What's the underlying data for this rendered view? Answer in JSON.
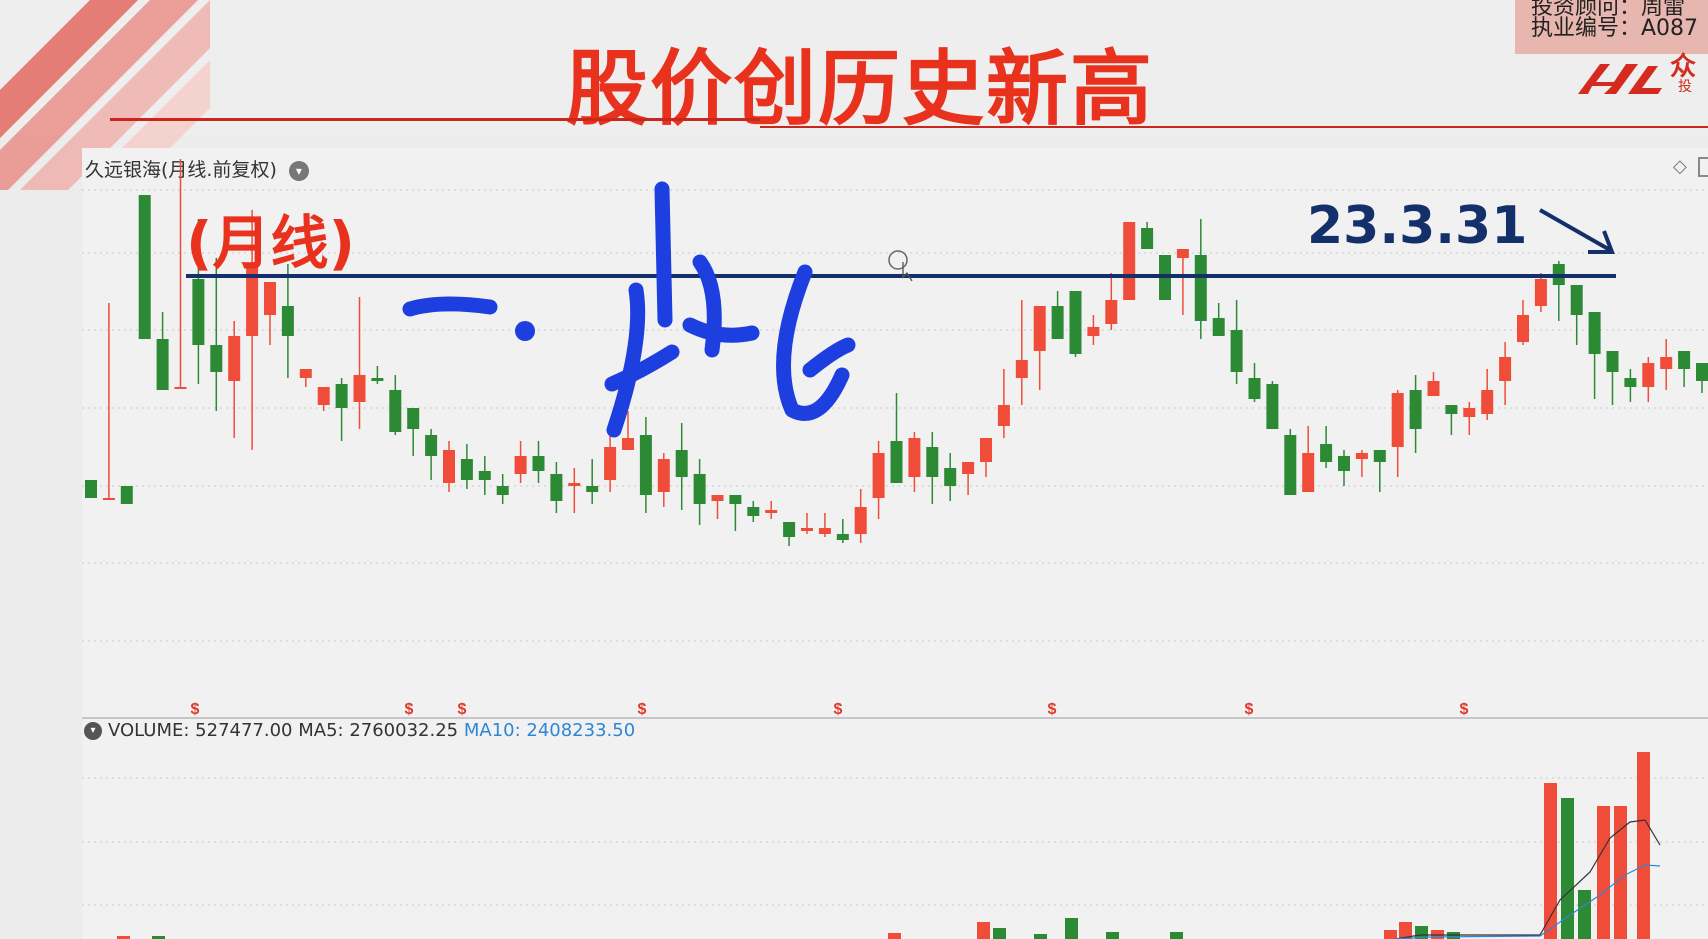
{
  "banner": {
    "title": "股价创历史新高",
    "advisor_line1": "投资顾问：周雷",
    "advisor_line2": "执业编号：A087",
    "logo_text": "众",
    "logo_sub": "投"
  },
  "chart": {
    "stock_label": "久远银海(月线.前复权)",
    "annotation_period": "(月线)",
    "annotation_date": "23.3.31",
    "handwriting": "一."
  },
  "volume": {
    "label": "VOLUME: 527477.00",
    "ma5": "MA5: 2760032.25",
    "ma10": "MA10: 2408233.50"
  },
  "colors": {
    "up": "#ef4c3a",
    "down": "#2c8a35",
    "title_red": "#e8321e",
    "annotation_navy": "#14306a",
    "handwriting_blue": "#1d3fe0",
    "ma10_blue": "#2e86d6"
  },
  "chart_data": {
    "type": "candlestick",
    "period": "monthly",
    "dividend_marker": "$",
    "candles": [
      [
        135,
        129,
        135,
        129
      ],
      [
        129,
        129,
        194,
        133
      ],
      [
        133,
        127,
        133,
        127
      ],
      [
        230,
        182,
        230,
        188
      ],
      [
        182,
        165,
        165,
        191
      ],
      [
        166,
        166,
        242,
        191
      ],
      [
        202,
        180,
        222,
        167
      ],
      [
        180,
        171,
        209,
        158
      ],
      [
        168,
        183,
        188,
        149
      ],
      [
        183,
        207,
        225,
        145
      ],
      [
        190,
        201,
        191,
        180
      ],
      [
        193,
        183,
        207,
        169
      ],
      [
        169,
        172,
        166,
        166
      ],
      [
        160,
        166,
        158,
        161
      ],
      [
        167,
        159,
        169,
        148
      ],
      [
        161,
        170,
        196,
        152
      ],
      [
        169,
        168,
        167,
        173
      ],
      [
        165,
        151,
        170,
        150
      ],
      [
        159,
        152,
        157,
        143
      ],
      [
        150,
        143,
        152,
        135
      ],
      [
        134,
        145,
        131,
        148
      ],
      [
        142,
        135,
        147,
        132
      ],
      [
        138,
        135,
        143,
        130
      ],
      [
        133,
        130,
        137,
        127
      ],
      [
        137,
        143,
        134,
        148
      ],
      [
        143,
        138,
        148,
        134
      ],
      [
        137,
        128,
        141,
        124
      ],
      [
        133,
        134,
        139,
        124
      ],
      [
        133,
        131,
        142,
        127
      ],
      [
        135,
        146,
        131,
        151
      ],
      [
        145,
        149,
        147,
        158
      ],
      [
        150,
        130,
        156,
        124
      ],
      [
        131,
        142,
        144,
        126
      ],
      [
        145,
        136,
        154,
        125
      ],
      [
        137,
        127,
        142,
        120
      ],
      [
        128,
        130,
        122,
        122
      ],
      [
        130,
        127,
        130,
        118
      ],
      [
        126,
        123,
        128,
        121
      ],
      [
        124,
        125,
        128,
        122
      ],
      [
        121,
        116,
        120,
        113
      ],
      [
        118,
        119,
        124,
        117
      ],
      [
        117,
        119,
        124,
        116
      ],
      [
        117,
        115,
        122,
        114
      ],
      [
        117,
        126,
        132,
        114
      ],
      [
        129,
        144,
        148,
        122
      ],
      [
        148,
        134,
        164,
        136
      ],
      [
        136,
        149,
        151,
        131
      ],
      [
        146,
        136,
        151,
        127
      ],
      [
        139,
        133,
        144,
        128
      ],
      [
        137,
        141,
        134,
        130
      ],
      [
        141,
        149,
        147,
        136
      ],
      [
        153,
        160,
        172,
        149
      ],
      [
        169,
        175,
        195,
        160
      ],
      [
        178,
        193,
        172,
        165
      ],
      [
        193,
        182,
        183,
        198
      ],
      [
        198,
        177,
        189,
        176
      ],
      [
        183,
        186,
        190,
        180
      ],
      [
        187,
        195,
        204,
        185
      ],
      [
        195,
        221,
        214,
        206
      ],
      [
        219,
        212,
        217,
        221
      ],
      [
        210,
        195,
        207,
        198
      ],
      [
        209,
        212,
        209,
        190
      ],
      [
        210,
        188,
        222,
        182
      ],
      [
        189,
        183,
        185,
        194
      ],
      [
        185,
        171,
        195,
        167
      ],
      [
        169,
        162,
        161,
        174
      ],
      [
        167,
        152,
        158,
        168
      ],
      [
        150,
        130,
        148,
        152
      ],
      [
        131,
        144,
        138,
        153
      ],
      [
        147,
        141,
        153,
        139
      ],
      [
        143,
        138,
        145,
        133
      ],
      [
        142,
        144,
        145,
        136
      ],
      [
        145,
        141,
        143,
        131
      ],
      [
        146,
        164,
        165,
        136
      ],
      [
        165,
        152,
        170,
        144
      ],
      [
        163,
        168,
        171,
        164
      ],
      [
        160,
        157,
        160,
        150
      ],
      [
        156,
        159,
        161,
        150
      ],
      [
        157,
        165,
        172,
        155
      ],
      [
        168,
        176,
        181,
        160
      ],
      [
        181,
        190,
        195,
        180
      ],
      [
        193,
        202,
        204,
        191
      ],
      [
        207,
        200,
        208,
        188
      ],
      [
        200,
        190,
        199,
        180
      ],
      [
        191,
        177,
        183,
        162
      ],
      [
        178,
        171,
        176,
        160
      ],
      [
        169,
        166,
        172,
        161
      ],
      [
        166,
        174,
        176,
        161
      ],
      [
        172,
        176,
        182,
        165
      ],
      [
        178,
        172,
        175,
        166
      ],
      [
        174,
        168,
        172,
        164
      ],
      [
        168,
        176,
        181,
        164
      ],
      [
        174,
        192,
        196,
        168
      ],
      [
        192,
        188,
        205,
        172
      ],
      [
        189,
        182,
        194,
        175
      ],
      [
        183,
        202,
        186,
        176
      ],
      [
        200,
        196,
        209,
        193
      ],
      [
        194,
        237,
        201,
        235
      ],
      [
        237,
        287,
        264,
        276
      ]
    ]
  }
}
